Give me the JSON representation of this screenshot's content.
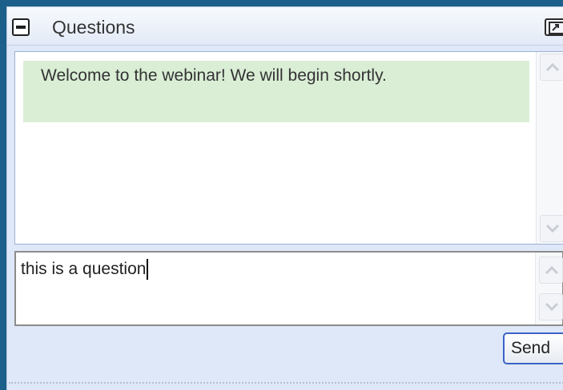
{
  "header": {
    "title": "Questions",
    "collapse_icon": "minus-icon",
    "popout_icon": "popout-window-icon"
  },
  "chat": {
    "messages": [
      {
        "text": "Welcome to the webinar! We will begin shortly."
      }
    ],
    "scroll_up_icon": "chevron-up-icon",
    "scroll_down_icon": "chevron-down-icon"
  },
  "input": {
    "value": "this is a question"
  },
  "send_label": "Send",
  "colors": {
    "frame": "#1b5f8a",
    "panel": "#dfe8f8",
    "message_bg": "#daeed6",
    "send_border": "#3a63c8"
  }
}
